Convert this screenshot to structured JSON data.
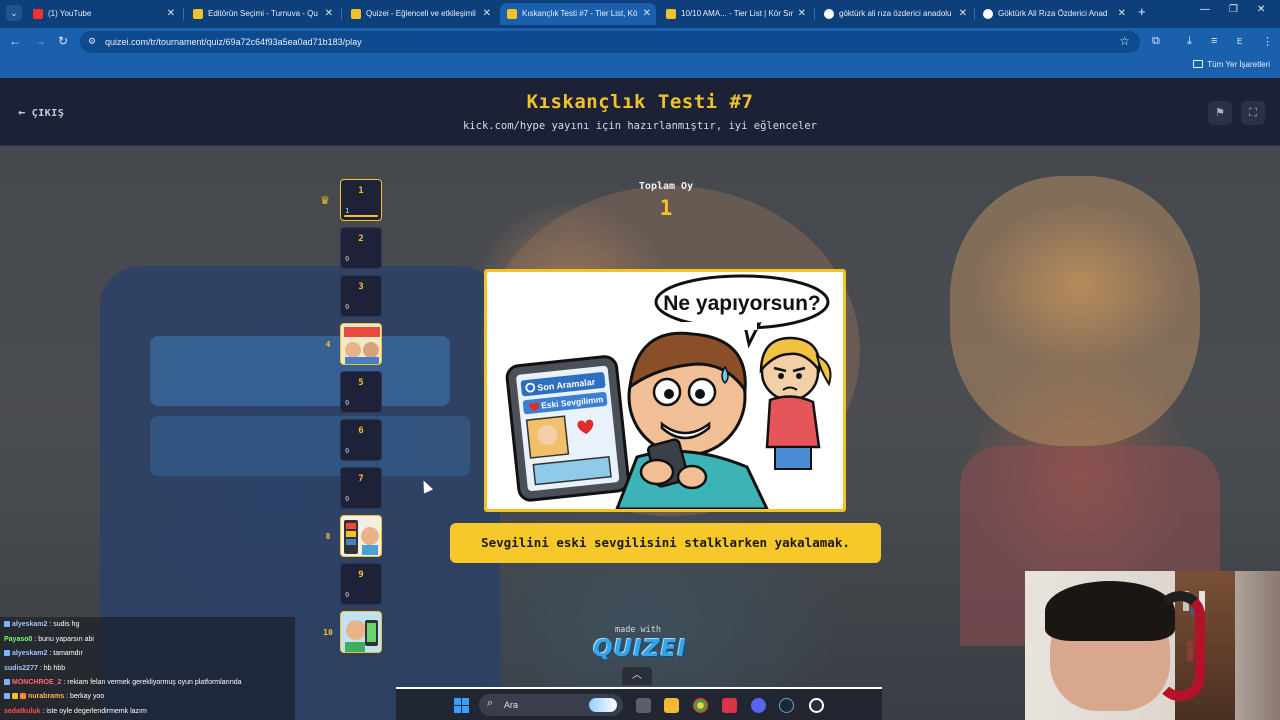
{
  "browser": {
    "tabs": [
      {
        "title": "(1) YouTube",
        "active": false
      },
      {
        "title": "Editörün Seçimi - Turnuva - Qu",
        "active": false
      },
      {
        "title": "Quizei - Eğlenceli ve etkileşimli",
        "active": false
      },
      {
        "title": "Kıskançlık Testi #7 - Tier List, Kö",
        "active": true
      },
      {
        "title": "10/10 AMA... - Tier List | Kör Sır",
        "active": false
      },
      {
        "title": "göktürk ali rıza özderici anadolu",
        "active": false
      },
      {
        "title": "Göktürk Ali Rıza Özderici Anad",
        "active": false
      }
    ],
    "url": "quizei.com/tr/tournament/quiz/69a72c64f93a5ea0ad71b183/play",
    "profile_initial": "E",
    "bookmarks_folder": "Tüm Yer İşaretleri"
  },
  "quiz": {
    "exit_label": "ÇIKIŞ",
    "title": "Kıskançlık Testi #7",
    "subtitle": "kick.com/hype yayını için hazırlanmıştır, iyi eğlenceler",
    "total_label": "Toplam Oy",
    "total_value": "1",
    "answer": "Sevgilini eski sevgilisini stalklarken yakalamak.",
    "made_with": "made with",
    "brand": "QUIZEI",
    "image_text": {
      "speech": "Ne yapıyorsun?",
      "search_label": "Son Aramalar",
      "result_label": "Eski Sevgilimm"
    },
    "ranks": [
      {
        "num": "1",
        "votes": "1",
        "leader": true
      },
      {
        "num": "2",
        "votes": "0"
      },
      {
        "num": "3",
        "votes": "0"
      },
      {
        "num": "4",
        "thumb": true
      },
      {
        "num": "5",
        "votes": "0"
      },
      {
        "num": "6",
        "votes": "0"
      },
      {
        "num": "7",
        "votes": "0"
      },
      {
        "num": "8",
        "thumb": true
      },
      {
        "num": "9",
        "votes": "0"
      },
      {
        "num": "10",
        "thumb": true
      }
    ]
  },
  "chat": [
    {
      "user": "alyeskam2",
      "text": ": sudis hg",
      "color": "#9fc2ff"
    },
    {
      "user": "Payaso0",
      "text": ": bunu yaparsın abi",
      "color": "#6dff6d"
    },
    {
      "user": "alyeskam2",
      "text": ": tamamdır",
      "color": "#9fc2ff"
    },
    {
      "user": "sudis2277",
      "text": ": hb hbb",
      "color": "#9fc2ff"
    },
    {
      "user": "MONCHROE_2",
      "text": ": rekiam felan vermek gerekliyormuş oyun platformlarında",
      "color": "#ff6b6b"
    },
    {
      "user": "nurabrams",
      "text": ": berkay yoo",
      "color": "#ffb35a"
    },
    {
      "user": "sedatkuluk",
      "text": ": iste oyle degerlendirmemk lazım",
      "color": "#ff4d4d"
    }
  ],
  "taskbar": {
    "search_placeholder": "Ara"
  },
  "colors": {
    "accent": "#f2c228",
    "header_bg": "#1c2136",
    "chrome": "#1b60ad"
  }
}
